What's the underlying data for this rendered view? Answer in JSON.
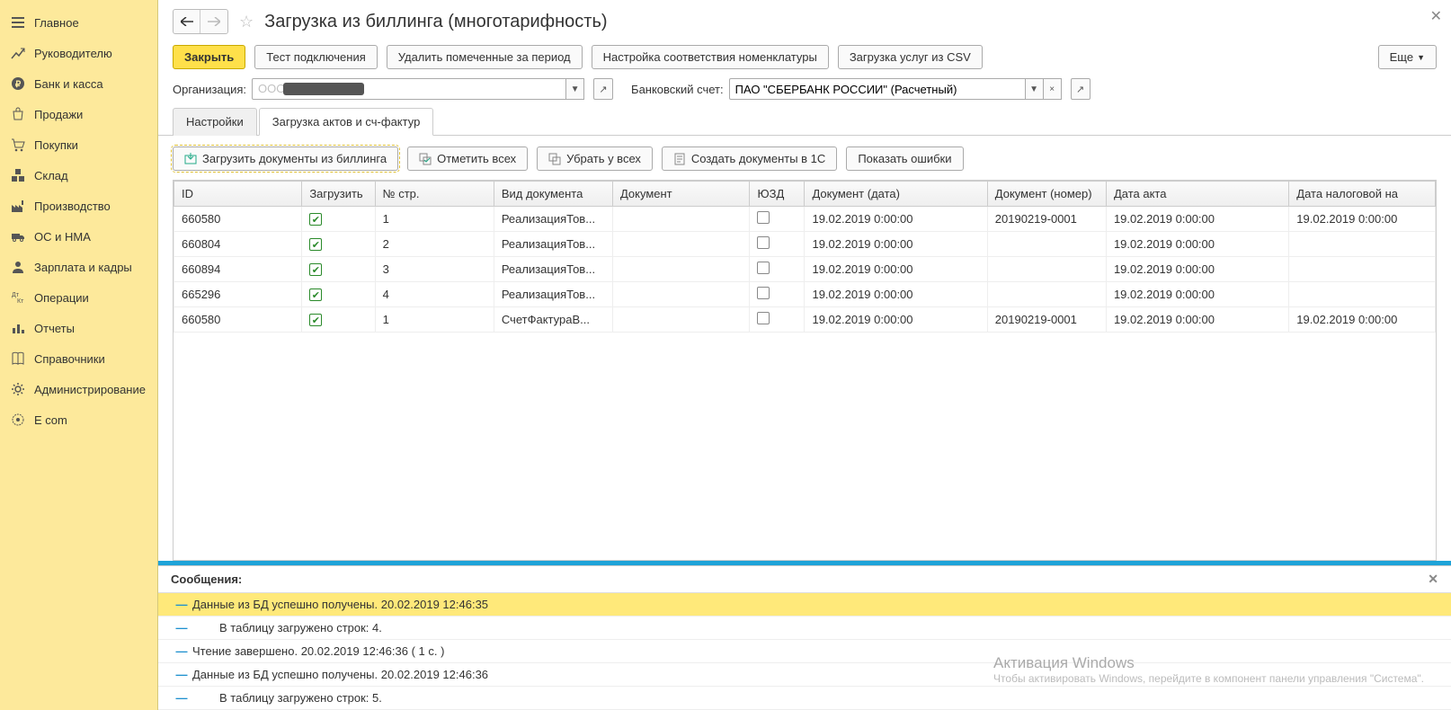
{
  "sidebar": {
    "items": [
      {
        "label": "Главное",
        "icon": "menu"
      },
      {
        "label": "Руководителю",
        "icon": "chart-up"
      },
      {
        "label": "Банк и касса",
        "icon": "ruble"
      },
      {
        "label": "Продажи",
        "icon": "bag"
      },
      {
        "label": "Покупки",
        "icon": "cart"
      },
      {
        "label": "Склад",
        "icon": "boxes"
      },
      {
        "label": "Производство",
        "icon": "factory"
      },
      {
        "label": "ОС и НМА",
        "icon": "truck"
      },
      {
        "label": "Зарплата и кадры",
        "icon": "person"
      },
      {
        "label": "Операции",
        "icon": "dtkt"
      },
      {
        "label": "Отчеты",
        "icon": "bar"
      },
      {
        "label": "Справочники",
        "icon": "book"
      },
      {
        "label": "Администрирование",
        "icon": "gear"
      },
      {
        "label": "E com",
        "icon": "ecom"
      }
    ]
  },
  "header": {
    "title": "Загрузка из биллинга (многотарифность)"
  },
  "cmdbar": {
    "close": "Закрыть",
    "test": "Тест подключения",
    "delete_marked": "Удалить помеченные за период",
    "mapping": "Настройка соответствия номенклатуры",
    "load_csv": "Загрузка услуг из CSV",
    "more": "Еще"
  },
  "form": {
    "org_label": "Организация:",
    "org_value": "ООО",
    "bank_label": "Банковский счет:",
    "bank_value": "ПАО \"СБЕРБАНК РОССИИ\" (Расчетный)"
  },
  "tabs": {
    "settings": "Настройки",
    "load": "Загрузка актов и сч-фактур"
  },
  "inner": {
    "load_docs": "Загрузить документы из биллинга",
    "check_all": "Отметить всех",
    "uncheck_all": "Убрать у всех",
    "create_docs": "Создать документы в 1С",
    "show_errors": "Показать ошибки"
  },
  "columns": [
    "ID",
    "Загрузить",
    "№ стр.",
    "Вид документа",
    "Документ",
    "ЮЗД",
    "Документ (дата)",
    "Документ (номер)",
    "Дата акта",
    "Дата налоговой на"
  ],
  "rows": [
    {
      "id": "660580",
      "load": true,
      "n": "1",
      "kind": "РеализацияТов...",
      "doc": "",
      "uzd": false,
      "date": "19.02.2019 0:00:00",
      "num": "20190219-0001",
      "act": "19.02.2019 0:00:00",
      "tax": "19.02.2019 0:00:00"
    },
    {
      "id": "660804",
      "load": true,
      "n": "2",
      "kind": "РеализацияТов...",
      "doc": "",
      "uzd": false,
      "date": "19.02.2019 0:00:00",
      "num": "",
      "act": "19.02.2019 0:00:00",
      "tax": ""
    },
    {
      "id": "660894",
      "load": true,
      "n": "3",
      "kind": "РеализацияТов...",
      "doc": "",
      "uzd": false,
      "date": "19.02.2019 0:00:00",
      "num": "",
      "act": "19.02.2019 0:00:00",
      "tax": ""
    },
    {
      "id": "665296",
      "load": true,
      "n": "4",
      "kind": "РеализацияТов...",
      "doc": "",
      "uzd": false,
      "date": "19.02.2019 0:00:00",
      "num": "",
      "act": "19.02.2019 0:00:00",
      "tax": ""
    },
    {
      "id": "660580",
      "load": true,
      "n": "1",
      "kind": "СчетФактураВ...",
      "doc": "",
      "uzd": false,
      "date": "19.02.2019 0:00:00",
      "num": "20190219-0001",
      "act": "19.02.2019 0:00:00",
      "tax": "19.02.2019 0:00:00"
    }
  ],
  "messages": {
    "title": "Сообщения:",
    "items": [
      {
        "text": "Данные из БД успешно получены. 20.02.2019 12:46:35",
        "indent": false,
        "sel": true
      },
      {
        "text": "В таблицу загружено строк: 4.",
        "indent": true,
        "sel": false
      },
      {
        "text": "Чтение завершено.  20.02.2019 12:46:36 ( 1 с. )",
        "indent": false,
        "sel": false
      },
      {
        "text": "Данные из БД успешно получены. 20.02.2019 12:46:36",
        "indent": false,
        "sel": false
      },
      {
        "text": "В таблицу загружено строк: 5.",
        "indent": true,
        "sel": false
      }
    ]
  },
  "watermark": {
    "title": "Активация Windows",
    "sub": "Чтобы активировать Windows, перейдите в компонент панели управления \"Система\"."
  }
}
